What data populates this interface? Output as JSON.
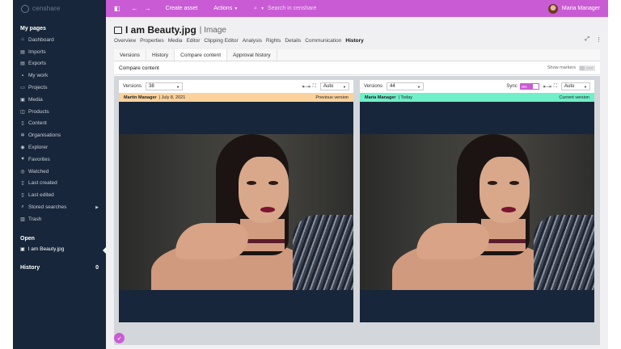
{
  "topbar": {
    "logo_text": "censhare",
    "create_asset": "Create asset",
    "actions": "Actions",
    "search_placeholder": "Search in censhare",
    "user_name": "Maria Manager",
    "accent": "#c95bd4"
  },
  "sidebar": {
    "my_pages": "My pages",
    "items": [
      {
        "label": "Dashboard",
        "icon": "home-icon"
      },
      {
        "label": "Imports",
        "icon": "import-icon"
      },
      {
        "label": "Exports",
        "icon": "export-icon"
      },
      {
        "label": "My work",
        "icon": "briefcase-icon"
      },
      {
        "label": "Projects",
        "icon": "folder-icon"
      },
      {
        "label": "Media",
        "icon": "image-icon"
      },
      {
        "label": "Products",
        "icon": "box-icon"
      },
      {
        "label": "Content",
        "icon": "document-icon"
      },
      {
        "label": "Organisations",
        "icon": "organisation-icon"
      },
      {
        "label": "Explorer",
        "icon": "compass-icon"
      },
      {
        "label": "Favorites",
        "icon": "heart-icon"
      },
      {
        "label": "Watched",
        "icon": "eye-icon"
      },
      {
        "label": "Last created",
        "icon": "file-plus-icon"
      },
      {
        "label": "Last edited",
        "icon": "file-edit-icon"
      },
      {
        "label": "Stored searches",
        "icon": "search-icon"
      },
      {
        "label": "Trash",
        "icon": "trash-icon"
      }
    ],
    "open_label": "Open",
    "open_item": "I am Beauty.jpg",
    "history_label": "History",
    "history_count": "0"
  },
  "asset": {
    "title": "I am Beauty.jpg",
    "type": "Image",
    "tabs": [
      "Overview",
      "Properties",
      "Media",
      "Editor",
      "Clipping Editor",
      "Analysis",
      "Rights",
      "Details",
      "Communication",
      "History"
    ]
  },
  "history": {
    "sub_tabs": [
      "Versions",
      "History",
      "Compare content",
      "Approval history"
    ],
    "compare_title": "Compare content",
    "show_markers": "Show markers",
    "markers_state": "OFF"
  },
  "left_pane": {
    "versions_label": "Versions",
    "version": "38",
    "zoom": "Auto",
    "author": "Martin Manager",
    "date": "| July 8, 2021",
    "tag": "Previous version",
    "bar_color": "#fbd29c"
  },
  "right_pane": {
    "versions_label": "Versions",
    "version": "44",
    "sync_label": "Sync",
    "sync_state": "ON",
    "zoom": "Auto",
    "author": "Maria Manager",
    "date": "| Today",
    "tag": "Current version",
    "bar_color": "#6ff0c8"
  }
}
